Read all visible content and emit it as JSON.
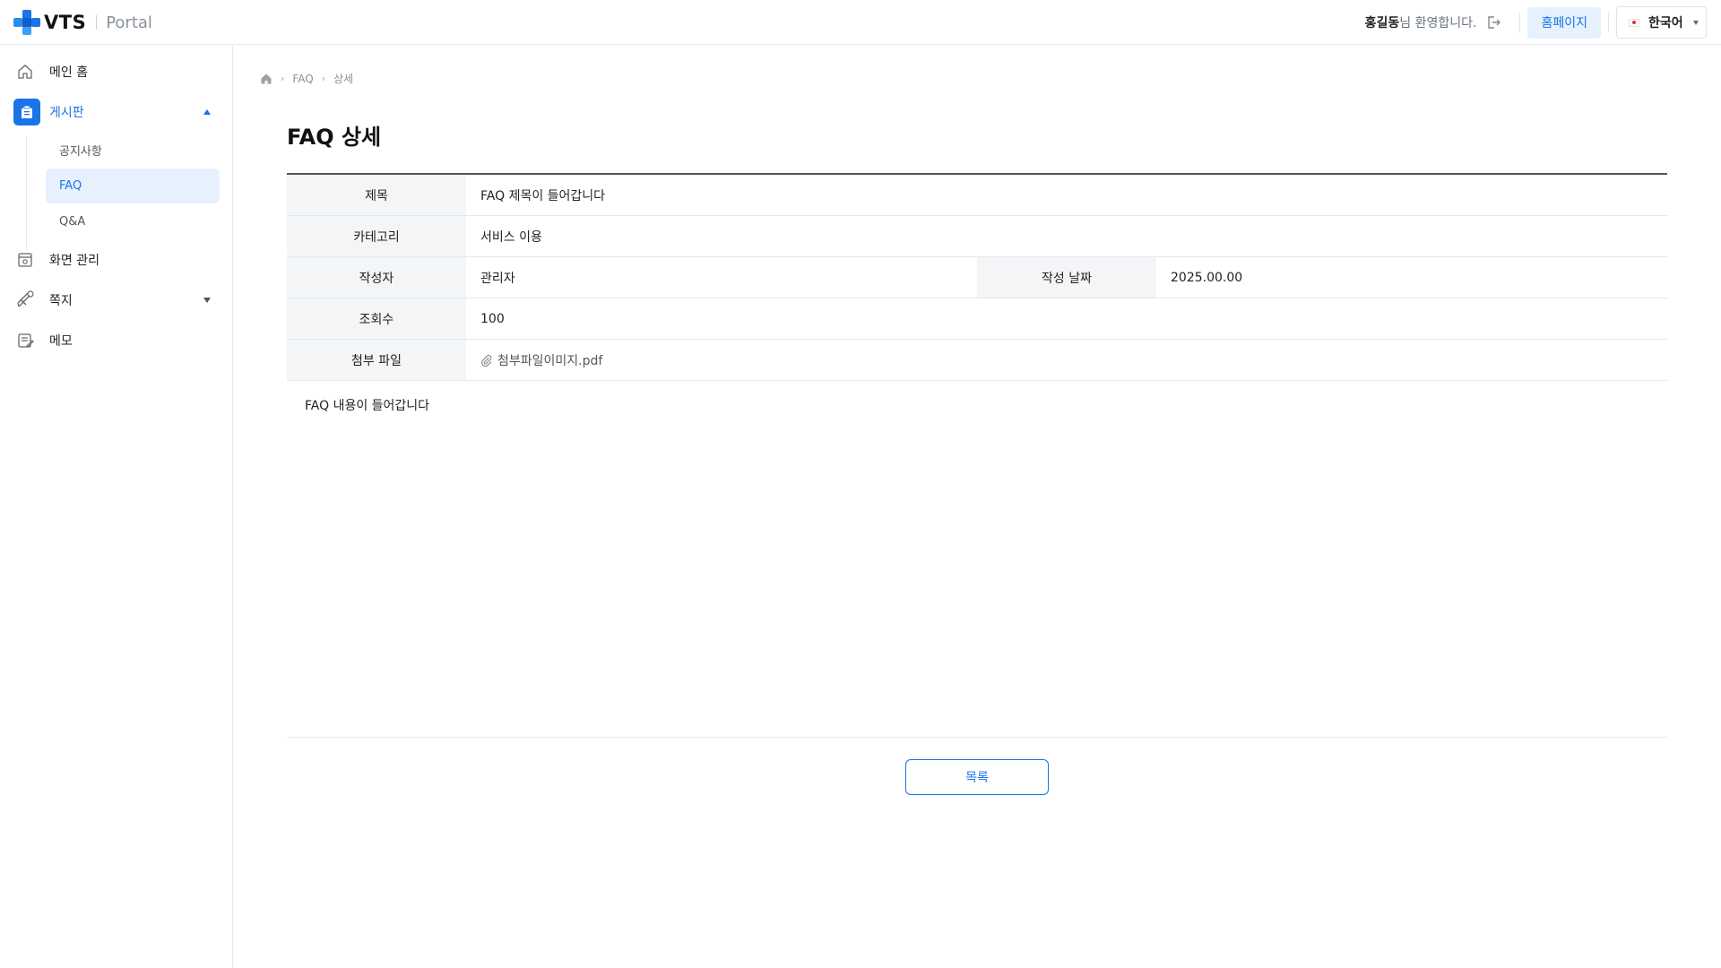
{
  "colors": {
    "accent": "#1a73e8",
    "accent_light": "#e6f1fd",
    "header_cell_bg": "#f3f5f7"
  },
  "header": {
    "logo_text": "VTS",
    "logo_portal": "Portal",
    "user_name": "홍길동",
    "welcome_suffix": "님 환영합니다.",
    "homepage_label": "홈페이지",
    "language": "한국어"
  },
  "sidebar": {
    "items": [
      {
        "label": "메인 홈",
        "icon": "home-icon"
      },
      {
        "label": "게시판",
        "icon": "board-icon"
      },
      {
        "label": "화면 관리",
        "icon": "screen-manage-icon"
      },
      {
        "label": "쪽지",
        "icon": "message-icon"
      },
      {
        "label": "메모",
        "icon": "memo-icon"
      }
    ],
    "board_subitems": [
      {
        "label": "공지사항"
      },
      {
        "label": "FAQ"
      },
      {
        "label": "Q&A"
      }
    ]
  },
  "breadcrumb": {
    "items": [
      "FAQ",
      "상세"
    ]
  },
  "page": {
    "title": "FAQ 상세",
    "fields": {
      "title_label": "제목",
      "title_value": "FAQ 제목이 들어갑니다",
      "category_label": "카테고리",
      "category_value": "서비스 이용",
      "author_label": "작성자",
      "author_value": "관리자",
      "date_label": "작성 날짜",
      "date_value": "2025.00.00",
      "views_label": "조회수",
      "views_value": "100",
      "attachment_label": "첨부 파일",
      "attachment_value": "첨부파일이미지.pdf"
    },
    "content": "FAQ 내용이 들어갑니다",
    "list_button": "목록"
  }
}
